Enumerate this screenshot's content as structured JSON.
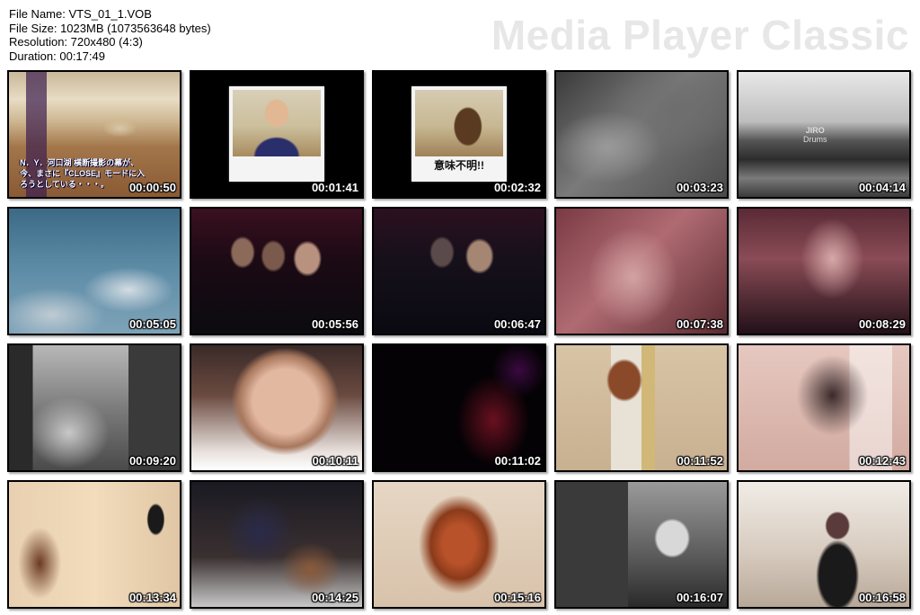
{
  "file_info": {
    "name_label": "File Name: VTS_01_1.VOB",
    "size_label": "File Size: 1023MB (1073563648 bytes)",
    "resolution_label": "Resolution: 720x480 (4:3)",
    "duration_label": "Duration: 00:17:49"
  },
  "watermark": "Media Player Classic",
  "thumbnails": [
    {
      "time": "00:00:50",
      "subtitle": "N．Y．河口湖 横断撮影の幕が、今、まさに『CLOSE』モードに入ろうとしている・・・。"
    },
    {
      "time": "00:01:41"
    },
    {
      "time": "00:02:32",
      "caption": "意味不明!!"
    },
    {
      "time": "00:03:23"
    },
    {
      "time": "00:04:14",
      "overlay": "JIRO",
      "overlay_sub": "Drums"
    },
    {
      "time": "00:05:05"
    },
    {
      "time": "00:05:56"
    },
    {
      "time": "00:06:47"
    },
    {
      "time": "00:07:38"
    },
    {
      "time": "00:08:29"
    },
    {
      "time": "00:09:20"
    },
    {
      "time": "00:10:11"
    },
    {
      "time": "00:11:02"
    },
    {
      "time": "00:11:52"
    },
    {
      "time": "00:12:43"
    },
    {
      "time": "00:13:34"
    },
    {
      "time": "00:14:25"
    },
    {
      "time": "00:15:16"
    },
    {
      "time": "00:16:07"
    },
    {
      "time": "00:16:58"
    }
  ]
}
